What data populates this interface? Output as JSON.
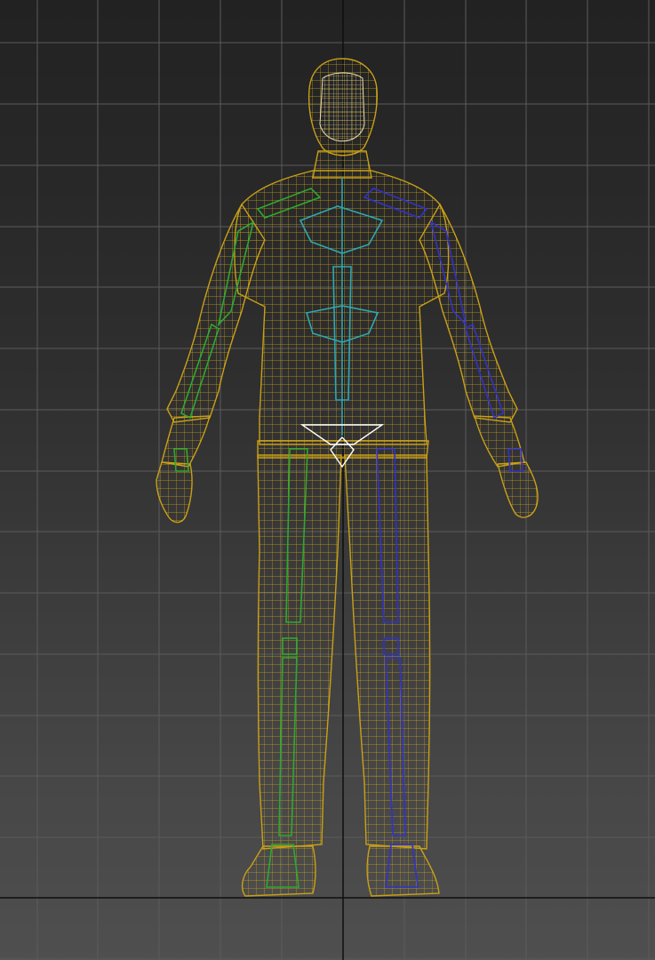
{
  "viewport": {
    "view": "front",
    "shading": "wireframe",
    "grid": true,
    "colors": {
      "background_top": "#222222",
      "background_bottom": "#4f4f4f",
      "grid_line": "#5b5b5b",
      "axis_line": "#0e0e0e",
      "mesh": "#c9a017",
      "head_detail": "#e8dfb0",
      "bone_center": "#2fa8b0",
      "bone_left": "#2fa82f",
      "bone_right": "#3232c8"
    }
  },
  "character": {
    "name": "",
    "type": "biped-human-wireframe",
    "pose": "A-pose"
  }
}
